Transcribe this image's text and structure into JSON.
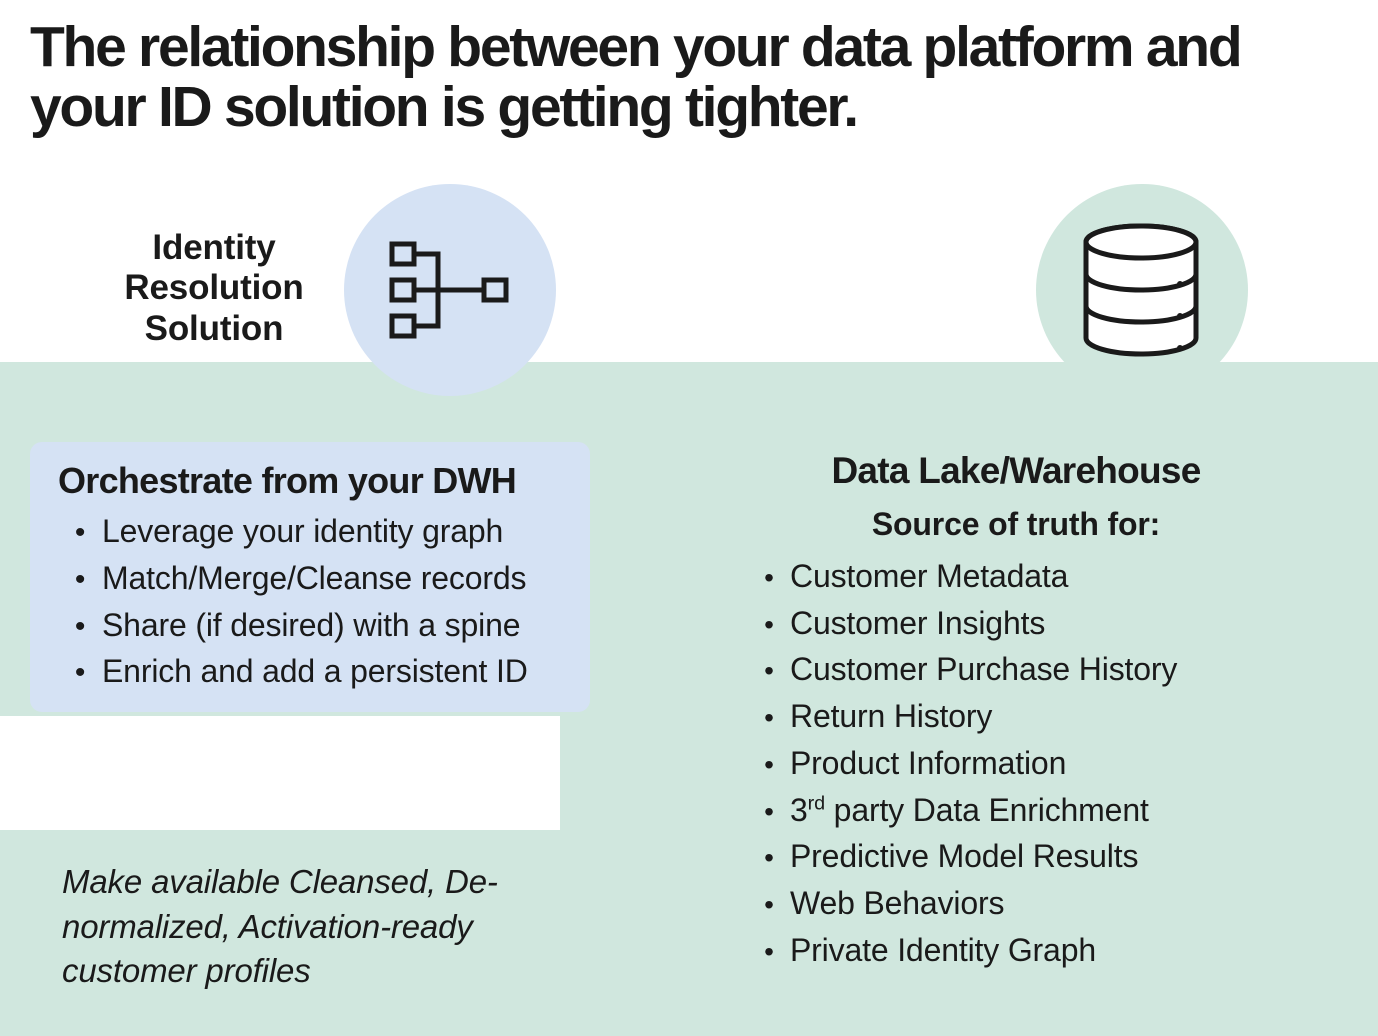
{
  "title": "The relationship between your data platform and your ID solution is getting tighter.",
  "identity": {
    "label": "Identity Resolution Solution"
  },
  "orchestrate": {
    "heading": "Orchestrate from your DWH",
    "items": [
      "Leverage your identity graph",
      "Match/Merge/Cleanse records",
      "Share (if desired) with a spine",
      "Enrich and add a persistent ID"
    ]
  },
  "profiles_note": "Make available Cleansed, De-normalized, Activation-ready customer profiles",
  "datalake": {
    "heading": "Data Lake/Warehouse",
    "subheading": "Source of truth for:",
    "items": [
      "Customer Metadata",
      "Customer Insights",
      "Customer Purchase History",
      "Return History",
      "Product Information",
      "3<sup>rd</sup> party Data Enrichment",
      "Predictive Model Results",
      "Web Behaviors",
      "Private Identity Graph"
    ]
  }
}
